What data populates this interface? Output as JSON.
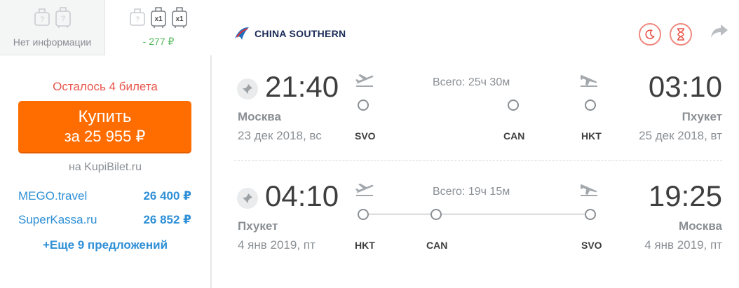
{
  "baggage": {
    "tab_no_info": {
      "caption": "Нет информации"
    },
    "tab_with_bag": {
      "badge1": "x1",
      "badge2": "x1",
      "price_diff": "- 277 ₽"
    }
  },
  "booking": {
    "remaining": "Осталось 4 билета",
    "buy_line1": "Купить",
    "buy_line2": "за 25 955 ₽",
    "seller": "на KupiBilet.ru",
    "offers": [
      {
        "name": "MEGO.travel",
        "price": "26 400 ₽"
      },
      {
        "name": "SuperKassa.ru",
        "price": "26 852 ₽"
      }
    ],
    "more": "+Еще 9 предложений"
  },
  "airline": {
    "name": "CHINA SOUTHERN"
  },
  "colors": {
    "accent": "#ff6d00",
    "link": "#2e8fd6",
    "alert": "#e8554b",
    "badge": "#f08a80",
    "green": "#52b85a"
  },
  "segments": [
    {
      "dep_time": "21:40",
      "dep_city": "Москва",
      "dep_date": "23 дек 2018, вс",
      "arr_time": "03:10",
      "arr_city": "Пхукет",
      "arr_date": "25 дек 2018, вт",
      "total": "Всего: 25ч 30м",
      "airports": [
        "SVO",
        "CAN",
        "HKT"
      ]
    },
    {
      "dep_time": "04:10",
      "dep_city": "Пхукет",
      "dep_date": "4 янв 2019, пт",
      "arr_time": "19:25",
      "arr_city": "Москва",
      "arr_date": "4 янв 2019, пт",
      "total": "Всего: 19ч 15м",
      "airports": [
        "HKT",
        "CAN",
        "SVO"
      ]
    }
  ],
  "icons": {
    "night": "moon-icon",
    "long_layover": "hourglass-icon",
    "share": "share-icon",
    "pin": "pin-icon",
    "takeoff": "plane-takeoff-icon",
    "landing": "plane-landing-icon",
    "bag": "bag-icon"
  }
}
